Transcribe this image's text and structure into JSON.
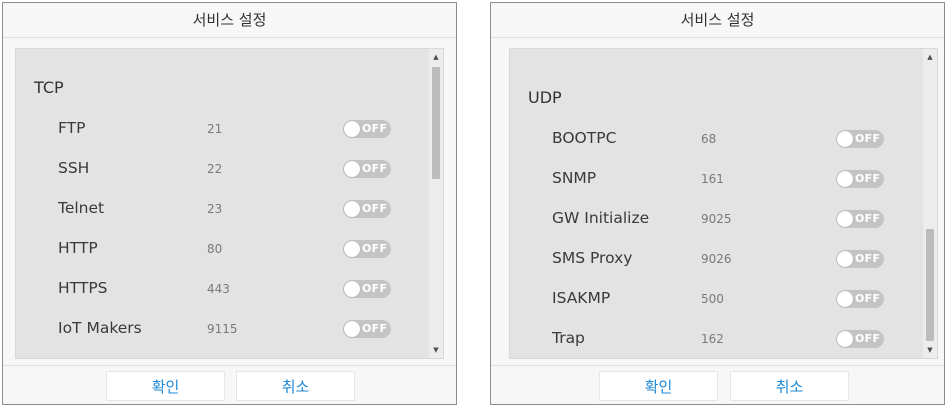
{
  "dialogs": [
    {
      "title": "서비스 설정",
      "group_title": "TCP",
      "items": [
        {
          "name": "FTP",
          "port": "21",
          "toggle": "OFF"
        },
        {
          "name": "SSH",
          "port": "22",
          "toggle": "OFF"
        },
        {
          "name": "Telnet",
          "port": "23",
          "toggle": "OFF"
        },
        {
          "name": "HTTP",
          "port": "80",
          "toggle": "OFF"
        },
        {
          "name": "HTTPS",
          "port": "443",
          "toggle": "OFF"
        },
        {
          "name": "IoT Makers",
          "port": "9115",
          "toggle": "OFF"
        },
        {
          "name": "",
          "port": "",
          "toggle": ""
        }
      ],
      "scroll_position": 0,
      "buttons": {
        "ok": "확인",
        "cancel": "취소"
      }
    },
    {
      "title": "서비스 설정",
      "group_title": "UDP",
      "items": [
        {
          "name": "BOOTPC",
          "port": "68",
          "toggle": "OFF"
        },
        {
          "name": "SNMP",
          "port": "161",
          "toggle": "OFF"
        },
        {
          "name": "GW Initialize",
          "port": "9025",
          "toggle": "OFF"
        },
        {
          "name": "SMS Proxy",
          "port": "9026",
          "toggle": "OFF"
        },
        {
          "name": "ISAKMP",
          "port": "500",
          "toggle": "OFF"
        },
        {
          "name": "Trap",
          "port": "162",
          "toggle": "OFF"
        }
      ],
      "scroll_position": 1,
      "buttons": {
        "ok": "확인",
        "cancel": "취소"
      }
    }
  ],
  "colors": {
    "toggle_off": "#c4c4c4",
    "button_text": "#1f8ad6",
    "content_bg": "#e3e3e3"
  }
}
